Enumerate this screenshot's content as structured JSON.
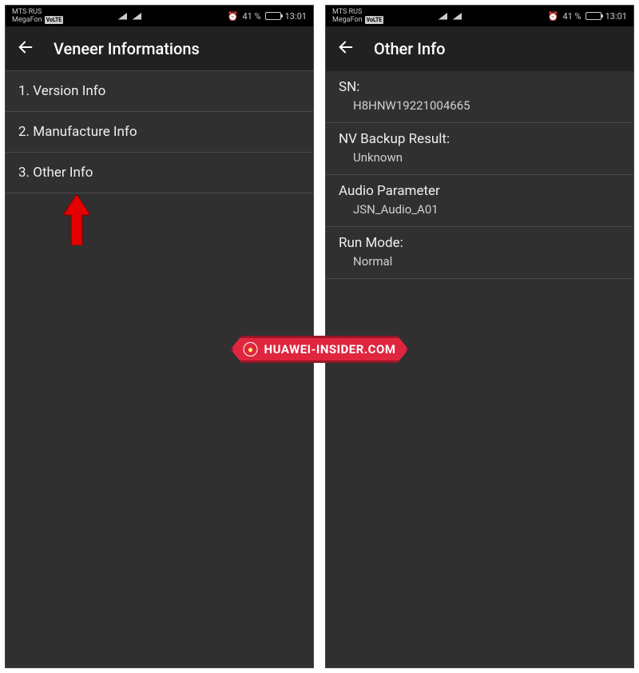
{
  "status": {
    "carrier1": "MTS RUS",
    "carrier2": "MegaFon",
    "volte": "VoLTE",
    "battery_pct": "41 %",
    "time": "13:01"
  },
  "left_screen": {
    "title": "Veneer Informations",
    "items": [
      "1. Version Info",
      "2. Manufacture Info",
      "3. Other Info"
    ]
  },
  "right_screen": {
    "title": "Other Info",
    "rows": [
      {
        "label": "SN:",
        "value": "H8HNW19221004665"
      },
      {
        "label": "NV Backup Result:",
        "value": "Unknown"
      },
      {
        "label": "Audio Parameter",
        "value": "JSN_Audio_A01"
      },
      {
        "label": "Run Mode:",
        "value": "Normal"
      }
    ]
  },
  "watermark": "HUAWEI-INSIDER.COM"
}
